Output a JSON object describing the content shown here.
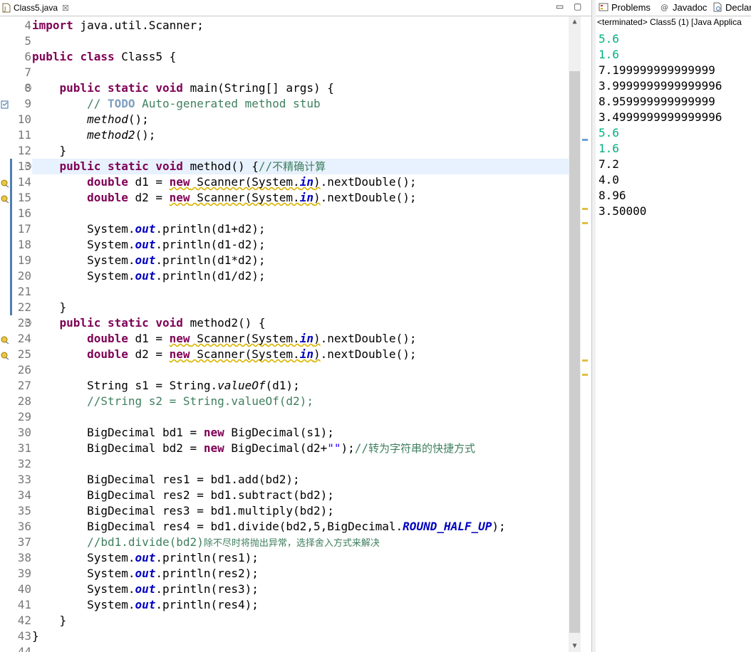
{
  "editor": {
    "tab_title": "Class5.java",
    "close_glyph": "☒",
    "minimize_glyph": "▭",
    "maximize_glyph": "▢",
    "lines": [
      {
        "n": "4",
        "t": "import java.util.Scanner;"
      },
      {
        "n": "5",
        "t": ""
      },
      {
        "n": "6",
        "t": "public class Class5 {"
      },
      {
        "n": "7",
        "t": ""
      },
      {
        "n": "8",
        "t": "    public static void main(String[] args) {"
      },
      {
        "n": "9",
        "t": "        // TODO Auto-generated method stub"
      },
      {
        "n": "10",
        "t": "        method();"
      },
      {
        "n": "11",
        "t": "        method2();"
      },
      {
        "n": "12",
        "t": "    }"
      },
      {
        "n": "13",
        "t": "    public static void method() {//不精确计算"
      },
      {
        "n": "14",
        "t": "        double d1 = new Scanner(System.in).nextDouble();"
      },
      {
        "n": "15",
        "t": "        double d2 = new Scanner(System.in).nextDouble();"
      },
      {
        "n": "16",
        "t": ""
      },
      {
        "n": "17",
        "t": "        System.out.println(d1+d2);"
      },
      {
        "n": "18",
        "t": "        System.out.println(d1-d2);"
      },
      {
        "n": "19",
        "t": "        System.out.println(d1*d2);"
      },
      {
        "n": "20",
        "t": "        System.out.println(d1/d2);"
      },
      {
        "n": "21",
        "t": ""
      },
      {
        "n": "22",
        "t": "    }"
      },
      {
        "n": "23",
        "t": "    public static void method2() {"
      },
      {
        "n": "24",
        "t": "        double d1 = new Scanner(System.in).nextDouble();"
      },
      {
        "n": "25",
        "t": "        double d2 = new Scanner(System.in).nextDouble();"
      },
      {
        "n": "26",
        "t": ""
      },
      {
        "n": "27",
        "t": "        String s1 = String.valueOf(d1);"
      },
      {
        "n": "28",
        "t": "        //String s2 = String.valueOf(d2);"
      },
      {
        "n": "29",
        "t": ""
      },
      {
        "n": "30",
        "t": "        BigDecimal bd1 = new BigDecimal(s1);"
      },
      {
        "n": "31",
        "t": "        BigDecimal bd2 = new BigDecimal(d2+\"\");//转为字符串的快捷方式"
      },
      {
        "n": "32",
        "t": ""
      },
      {
        "n": "33",
        "t": "        BigDecimal res1 = bd1.add(bd2);"
      },
      {
        "n": "34",
        "t": "        BigDecimal res2 = bd1.subtract(bd2);"
      },
      {
        "n": "35",
        "t": "        BigDecimal res3 = bd1.multiply(bd2);"
      },
      {
        "n": "36",
        "t": "        BigDecimal res4 = bd1.divide(bd2,5,BigDecimal.ROUND_HALF_UP);"
      },
      {
        "n": "37",
        "t": "        //bd1.divide(bd2)除不尽时将抛出异常，选择舍入方式来解决"
      },
      {
        "n": "38",
        "t": "        System.out.println(res1);"
      },
      {
        "n": "39",
        "t": "        System.out.println(res2);"
      },
      {
        "n": "40",
        "t": "        System.out.println(res3);"
      },
      {
        "n": "41",
        "t": "        System.out.println(res4);"
      },
      {
        "n": "42",
        "t": "    }"
      },
      {
        "n": "43",
        "t": "}"
      },
      {
        "n": "44",
        "t": ""
      }
    ]
  },
  "panel": {
    "tabs": [
      "Problems",
      "Javadoc",
      "Declar"
    ],
    "terminated_label": "<terminated> Class5 (1) [Java Applica",
    "console_lines": [
      {
        "text": "5.6",
        "color": "#00b080"
      },
      {
        "text": "1.6",
        "color": "#00b080"
      },
      {
        "text": "7.199999999999999",
        "color": "#000000"
      },
      {
        "text": "3.9999999999999996",
        "color": "#000000"
      },
      {
        "text": "8.959999999999999",
        "color": "#000000"
      },
      {
        "text": "3.4999999999999996",
        "color": "#000000"
      },
      {
        "text": "5.6",
        "color": "#00b080"
      },
      {
        "text": "1.6",
        "color": "#00b080"
      },
      {
        "text": "7.2",
        "color": "#000000"
      },
      {
        "text": "4.0",
        "color": "#000000"
      },
      {
        "text": "8.96",
        "color": "#000000"
      },
      {
        "text": "3.50000",
        "color": "#000000"
      }
    ]
  },
  "colors": {
    "keyword": "#7f0055",
    "comment": "#3f7f5f",
    "static_field": "#0000c0",
    "string": "#2a00ff",
    "console_input": "#00b080",
    "current_line": "#e8f2fe"
  }
}
